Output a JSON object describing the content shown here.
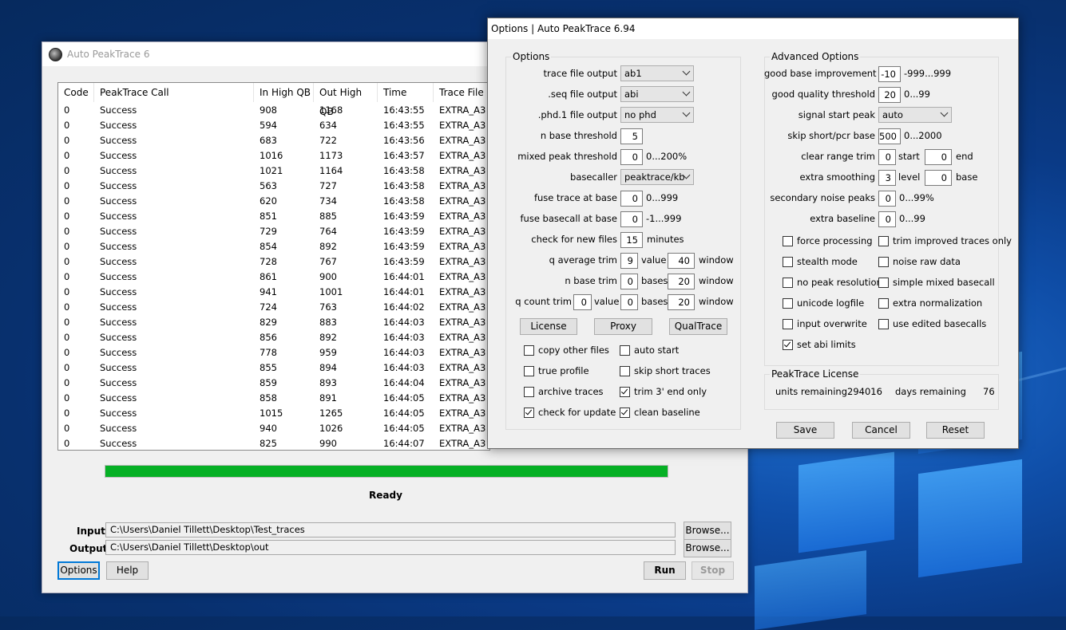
{
  "main_window": {
    "title": "Auto PeakTrace 6",
    "columns": [
      "Code",
      "PeakTrace Call",
      "In High QB",
      "Out High QB",
      "Time",
      "Trace File"
    ],
    "rows": [
      [
        "0",
        "Success",
        "908",
        "1168",
        "16:43:55",
        "EXTRA_A3"
      ],
      [
        "0",
        "Success",
        "594",
        "634",
        "16:43:55",
        "EXTRA_A3"
      ],
      [
        "0",
        "Success",
        "683",
        "722",
        "16:43:56",
        "EXTRA_A3"
      ],
      [
        "0",
        "Success",
        "1016",
        "1173",
        "16:43:57",
        "EXTRA_A3"
      ],
      [
        "0",
        "Success",
        "1021",
        "1164",
        "16:43:58",
        "EXTRA_A3"
      ],
      [
        "0",
        "Success",
        "563",
        "727",
        "16:43:58",
        "EXTRA_A3"
      ],
      [
        "0",
        "Success",
        "620",
        "734",
        "16:43:58",
        "EXTRA_A3"
      ],
      [
        "0",
        "Success",
        "851",
        "885",
        "16:43:59",
        "EXTRA_A3"
      ],
      [
        "0",
        "Success",
        "729",
        "764",
        "16:43:59",
        "EXTRA_A3"
      ],
      [
        "0",
        "Success",
        "854",
        "892",
        "16:43:59",
        "EXTRA_A3"
      ],
      [
        "0",
        "Success",
        "728",
        "767",
        "16:43:59",
        "EXTRA_A3"
      ],
      [
        "0",
        "Success",
        "861",
        "900",
        "16:44:01",
        "EXTRA_A3"
      ],
      [
        "0",
        "Success",
        "941",
        "1001",
        "16:44:01",
        "EXTRA_A3"
      ],
      [
        "0",
        "Success",
        "724",
        "763",
        "16:44:02",
        "EXTRA_A3"
      ],
      [
        "0",
        "Success",
        "829",
        "883",
        "16:44:03",
        "EXTRA_A3"
      ],
      [
        "0",
        "Success",
        "856",
        "892",
        "16:44:03",
        "EXTRA_A3"
      ],
      [
        "0",
        "Success",
        "778",
        "959",
        "16:44:03",
        "EXTRA_A3"
      ],
      [
        "0",
        "Success",
        "855",
        "894",
        "16:44:03",
        "EXTRA_A3"
      ],
      [
        "0",
        "Success",
        "859",
        "893",
        "16:44:04",
        "EXTRA_A3"
      ],
      [
        "0",
        "Success",
        "858",
        "891",
        "16:44:05",
        "EXTRA_A3"
      ],
      [
        "0",
        "Success",
        "1015",
        "1265",
        "16:44:05",
        "EXTRA_A3"
      ],
      [
        "0",
        "Success",
        "940",
        "1026",
        "16:44:05",
        "EXTRA_A3"
      ],
      [
        "0",
        "Success",
        "825",
        "990",
        "16:44:07",
        "EXTRA_A3"
      ]
    ],
    "progress": 1.0,
    "status": "Ready",
    "input_label": "Input",
    "input_path": "C:\\Users\\Daniel Tillett\\Desktop\\Test_traces",
    "output_label": "Output",
    "output_path": "C:\\Users\\Daniel Tillett\\Desktop\\out",
    "browse_label": "Browse...",
    "options_label": "Options",
    "help_label": "Help",
    "run_label": "Run",
    "stop_label": "Stop"
  },
  "options_dialog": {
    "title": "Options | Auto PeakTrace 6.94",
    "options_group": "Options",
    "trace_file_output": {
      "label": "trace file output",
      "value": "ab1"
    },
    "seq_file_output": {
      "label": ".seq file output",
      "value": "abi"
    },
    "phd_file_output": {
      "label": ".phd.1 file output",
      "value": "no phd"
    },
    "n_base_threshold": {
      "label": "n base threshold",
      "value": "5"
    },
    "mixed_peak_threshold": {
      "label": "mixed peak threshold",
      "value": "0",
      "range": "0...200%"
    },
    "basecaller": {
      "label": "basecaller",
      "value": "peaktrace/kb"
    },
    "fuse_trace_at_base": {
      "label": "fuse trace at base",
      "value": "0",
      "range": "0...999"
    },
    "fuse_basecall_at_base": {
      "label": "fuse basecall at base",
      "value": "0",
      "range": "-1...999"
    },
    "check_for_new_files": {
      "label": "check for new files",
      "value": "15",
      "unit": "minutes"
    },
    "q_average_trim": {
      "label": "q average trim",
      "value": "9",
      "value_label": "value",
      "window": "40",
      "window_label": "window"
    },
    "n_base_trim": {
      "label": "n base trim",
      "value": "0",
      "bases_label": "bases",
      "window": "20",
      "window_label": "window"
    },
    "q_count_trim": {
      "label": "q count trim",
      "value": "0",
      "value_label": "value",
      "bases": "0",
      "bases_label": "bases",
      "window": "20",
      "window_label": "window"
    },
    "license_btn": "License",
    "proxy_btn": "Proxy",
    "qualtrace_btn": "QualTrace",
    "left_checks": [
      {
        "label": "copy other files",
        "checked": false
      },
      {
        "label": "auto start",
        "checked": false
      },
      {
        "label": "true profile",
        "checked": false
      },
      {
        "label": "skip short traces",
        "checked": false
      },
      {
        "label": "archive traces",
        "checked": false
      },
      {
        "label": "trim 3' end only",
        "checked": true
      },
      {
        "label": "check for update",
        "checked": true
      },
      {
        "label": "clean baseline",
        "checked": true
      }
    ],
    "advanced_group": "Advanced Options",
    "good_base_improvement": {
      "label": "good base improvement",
      "value": "-10",
      "range": "-999...999"
    },
    "good_quality_threshold": {
      "label": "good quality threshold",
      "value": "20",
      "range": "0...99"
    },
    "signal_start_peak": {
      "label": "signal start peak",
      "value": "auto"
    },
    "skip_short_pcr_base": {
      "label": "skip short/pcr base",
      "value": "500",
      "range": "0...2000"
    },
    "clear_range_trim": {
      "label": "clear range trim",
      "start": "0",
      "start_label": "start",
      "end": "0",
      "end_label": "end"
    },
    "extra_smoothing": {
      "label": "extra smoothing",
      "level": "3",
      "level_label": "level",
      "base": "0",
      "base_label": "base"
    },
    "secondary_noise_peaks": {
      "label": "secondary noise peaks",
      "value": "0",
      "range": "0...99%"
    },
    "extra_baseline": {
      "label": "extra baseline",
      "value": "0",
      "range": "0...99"
    },
    "right_checks": [
      {
        "label": "force processing",
        "checked": false
      },
      {
        "label": "trim improved traces only",
        "checked": false
      },
      {
        "label": "stealth mode",
        "checked": false
      },
      {
        "label": "noise raw data",
        "checked": false
      },
      {
        "label": "no peak resolution",
        "checked": false
      },
      {
        "label": "simple mixed basecall",
        "checked": false
      },
      {
        "label": "unicode logfile",
        "checked": false
      },
      {
        "label": "extra normalization",
        "checked": false
      },
      {
        "label": "input overwrite",
        "checked": false
      },
      {
        "label": "use edited basecalls",
        "checked": false
      },
      {
        "label": "set abi limits",
        "checked": true
      }
    ],
    "license_group": "PeakTrace License",
    "units_remaining_label": "units remaining",
    "units_remaining": "294016",
    "days_remaining_label": "days remaining",
    "days_remaining": "76",
    "save_btn": "Save",
    "cancel_btn": "Cancel",
    "reset_btn": "Reset"
  }
}
